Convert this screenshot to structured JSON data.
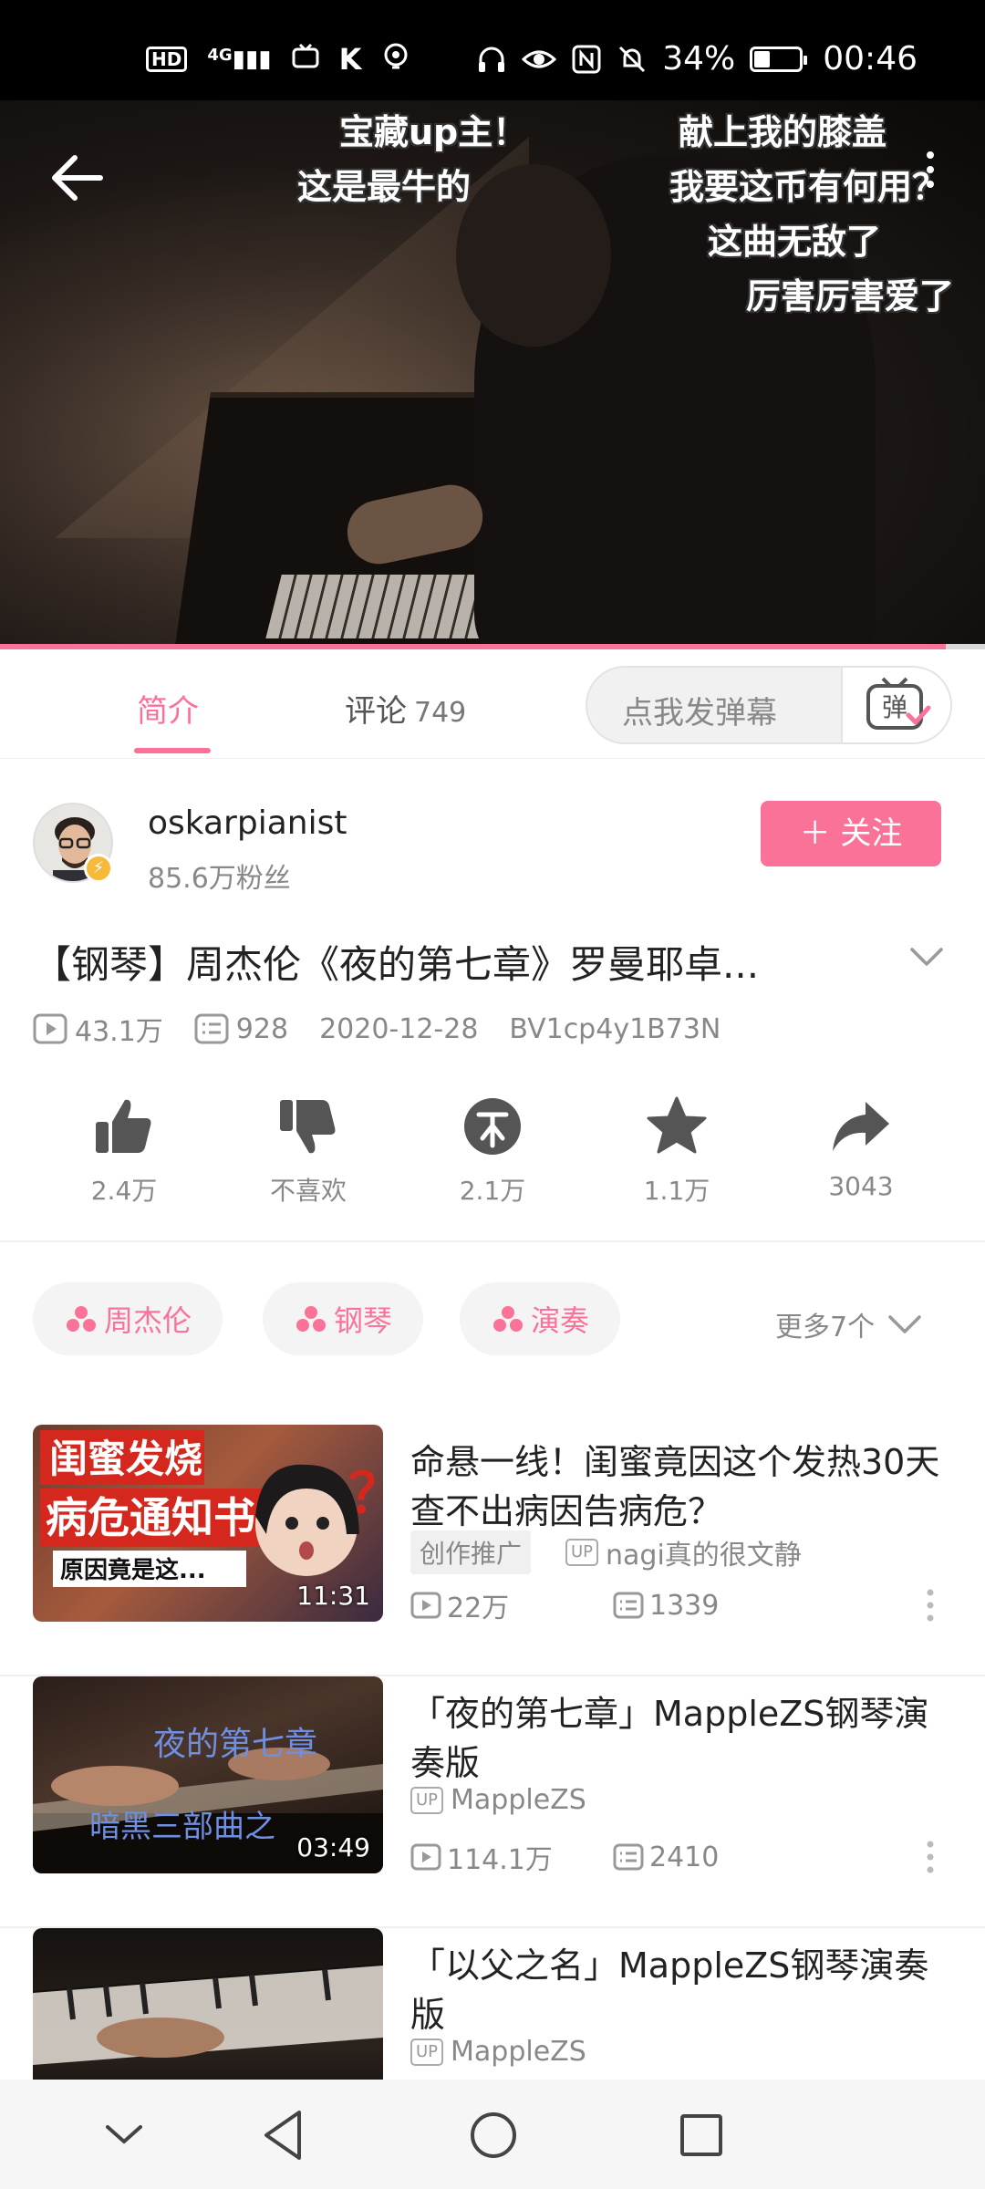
{
  "status_bar": {
    "left_icons": [
      "hd-icon",
      "signal-4g-icon",
      "tv-icon",
      "k-icon",
      "location-icon"
    ],
    "hd_label": "HD",
    "sim_label": "4G",
    "battery_text": "34%",
    "battery_level": 0.34,
    "time": "00:46"
  },
  "video": {
    "danmaku": [
      "宝藏up主！",
      "献上我的膝盖",
      "这是最牛的",
      "我要这币有何用？",
      "这曲无敌了",
      "厉害厉害爱了"
    ],
    "progress": 0.96
  },
  "tabs": {
    "intro": "简介",
    "comments": "评论",
    "comments_count": "749",
    "danmaku_placeholder": "点我发弹幕",
    "danmaku_button": "弹"
  },
  "uploader": {
    "name": "oskarpianist",
    "fans": "85.6万粉丝",
    "follow_label": "＋ 关注"
  },
  "video_info": {
    "title": "【钢琴】周杰伦《夜的第七章》罗曼耶卓...",
    "views": "43.1万",
    "danmaku_count": "928",
    "date": "2020-12-28",
    "bvid": "BV1cp4y1B73N"
  },
  "actions": [
    {
      "name": "like",
      "label": "2.4万"
    },
    {
      "name": "dislike",
      "label": "不喜欢"
    },
    {
      "name": "coin",
      "label": "2.1万"
    },
    {
      "name": "favorite",
      "label": "1.1万"
    },
    {
      "name": "share",
      "label": "3043"
    }
  ],
  "tags": [
    "周杰伦",
    "钢琴",
    "演奏"
  ],
  "more_tags": "更多7个",
  "recommendations": [
    {
      "title": "命悬一线！闺蜜竟因这个发热30天查不出病因告病危？",
      "badge": "创作推广",
      "up_tag": "UP",
      "uploader": "nagi真的很文静",
      "views": "22万",
      "comments": "1339",
      "duration": "11:31",
      "thumb_text_1": "闺蜜发烧",
      "thumb_text_2": "病危通知书",
      "thumb_text_3": "原因竟是这...",
      "thumb_text_4": "？"
    },
    {
      "title": "「夜的第七章」MappleZS钢琴演奏版",
      "up_tag": "UP",
      "uploader": "MappleZS",
      "views": "114.1万",
      "comments": "2410",
      "duration": "03:49",
      "thumb_text_1": "夜的第七章",
      "thumb_text_2": "暗黑三部曲之"
    },
    {
      "title": "「以父之名」MappleZS钢琴演奏版",
      "up_tag": "UP",
      "uploader": "MappleZS"
    }
  ],
  "colors": {
    "accent": "#fb7299",
    "secondary_text": "#888888",
    "status_bar_bg": "#000000"
  }
}
